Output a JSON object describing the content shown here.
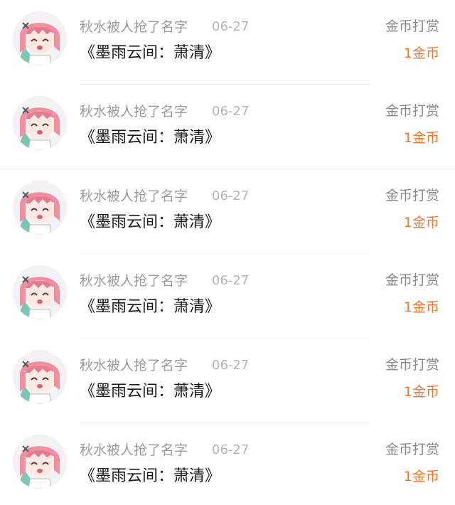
{
  "reward_list": [
    {
      "username": "秋水被人抢了名字",
      "date": "06-27",
      "book_title": "《墨雨云间：萧清》",
      "gift_type": "金币打赏",
      "amount": "1金币",
      "avatar_icon": "anime-girl-avatar-icon"
    },
    {
      "username": "秋水被人抢了名字",
      "date": "06-27",
      "book_title": "《墨雨云间：萧清》",
      "gift_type": "金币打赏",
      "amount": "1金币",
      "avatar_icon": "anime-girl-avatar-icon"
    },
    {
      "username": "秋水被人抢了名字",
      "date": "06-27",
      "book_title": "《墨雨云间：萧清》",
      "gift_type": "金币打赏",
      "amount": "1金币",
      "avatar_icon": "anime-girl-avatar-icon"
    },
    {
      "username": "秋水被人抢了名字",
      "date": "06-27",
      "book_title": "《墨雨云间：萧清》",
      "gift_type": "金币打赏",
      "amount": "1金币",
      "avatar_icon": "anime-girl-avatar-icon"
    },
    {
      "username": "秋水被人抢了名字",
      "date": "06-27",
      "book_title": "《墨雨云间：萧清》",
      "gift_type": "金币打赏",
      "amount": "1金币",
      "avatar_icon": "anime-girl-avatar-icon"
    },
    {
      "username": "秋水被人抢了名字",
      "date": "06-27",
      "book_title": "《墨雨云间：萧清》",
      "gift_type": "金币打赏",
      "amount": "1金币",
      "avatar_icon": "anime-girl-avatar-icon"
    }
  ],
  "colors": {
    "username": "#9a9a9a",
    "date": "#b4b4b4",
    "book_title": "#1a1a1a",
    "gift_type": "#888888",
    "amount": "#f0782d"
  }
}
